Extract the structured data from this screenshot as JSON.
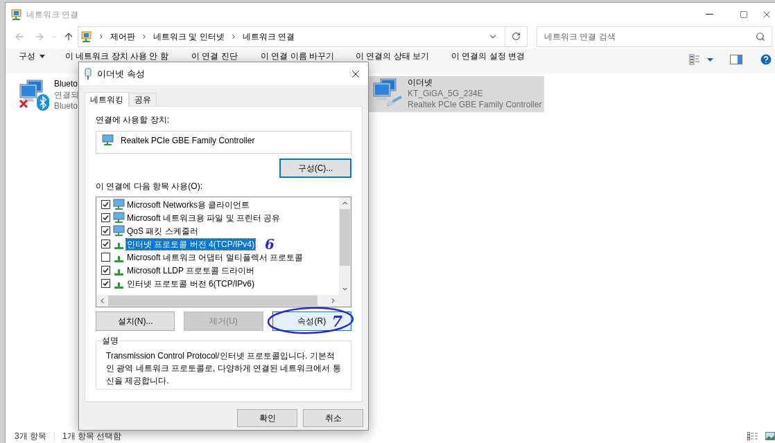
{
  "window": {
    "title": "네트워크 연결"
  },
  "address": {
    "path": [
      "제어판",
      "네트워크 및 인터넷",
      "네트워크 연결"
    ]
  },
  "search": {
    "placeholder": "네트워크 연결 검색"
  },
  "commands": [
    {
      "label": "구성",
      "kind": "menu"
    },
    {
      "label": "이 네트워크 장치 사용 안 함",
      "kind": "action"
    },
    {
      "label": "이 연결 진단",
      "kind": "action"
    },
    {
      "label": "이 연결 이름 바꾸기",
      "kind": "action"
    },
    {
      "label": "이 연결의 상태 보기",
      "kind": "action"
    },
    {
      "label": "이 연결의 설정 변경",
      "kind": "action"
    }
  ],
  "connections": [
    {
      "name": "Blueto",
      "status": "연결되",
      "device": "Blueto",
      "kind": "bluetooth",
      "connected": false,
      "selected": false
    },
    {
      "name": "이더넷",
      "status": "KT_GiGA_5G_234E",
      "device": "Realtek PCIe GBE Family Controller",
      "kind": "ethernet",
      "connected": true,
      "selected": true
    }
  ],
  "status_bar": {
    "count": "3개 항목",
    "selection": "1개 항목 선택함"
  },
  "dialog": {
    "title": "이더넷 속성",
    "tabs": [
      {
        "label": "네트워킹",
        "selected": true
      },
      {
        "label": "공유",
        "selected": false
      }
    ],
    "device_label": "연결에 사용할 장치:",
    "device": "Realtek PCIe GBE Family Controller",
    "configure_button": {
      "label": "구성(C)...",
      "focused": true,
      "hovered": false,
      "disabled": false
    },
    "items_label": "이 연결에 다음 항목 사용(O):",
    "items": [
      {
        "label": "Microsoft Networks용 클라이언트",
        "kind": "service",
        "checked": true,
        "selected": false
      },
      {
        "label": "Microsoft 네트워크용 파일 및 프린터 공유",
        "kind": "service",
        "checked": true,
        "selected": false
      },
      {
        "label": "QoS 패킷 스케줄러",
        "kind": "service",
        "checked": true,
        "selected": false
      },
      {
        "label": "인터넷 프로토콜 버전 4(TCP/IPv4)",
        "kind": "protocol",
        "checked": true,
        "selected": true
      },
      {
        "label": "Microsoft 네트워크 어댑터 멀티플렉서 프로토콜",
        "kind": "protocol",
        "checked": false,
        "selected": false
      },
      {
        "label": "Microsoft LLDP 프로토콜 드라이버",
        "kind": "protocol",
        "checked": true,
        "selected": false
      },
      {
        "label": "인터넷 프로토콜 버전 6(TCP/IPv6)",
        "kind": "protocol",
        "checked": true,
        "selected": false
      }
    ],
    "buttons": [
      {
        "label": "설치(N)...",
        "focused": false,
        "hovered": false,
        "disabled": false
      },
      {
        "label": "제거(U)",
        "focused": false,
        "hovered": false,
        "disabled": true
      },
      {
        "label": "속성(R)",
        "focused": false,
        "hovered": true,
        "disabled": false
      }
    ],
    "description_title": "설명",
    "description": "Transmission Control Protocol/인터넷 프로토콜입니다. 기본적인 광역 네트워크 프로토콜로, 다양하게 연결된 네트워크에서 통신을 제공합니다.",
    "footer_buttons": [
      {
        "label": "확인"
      },
      {
        "label": "취소"
      }
    ],
    "annotations": [
      {
        "text": "6"
      },
      {
        "text": "7"
      }
    ]
  }
}
